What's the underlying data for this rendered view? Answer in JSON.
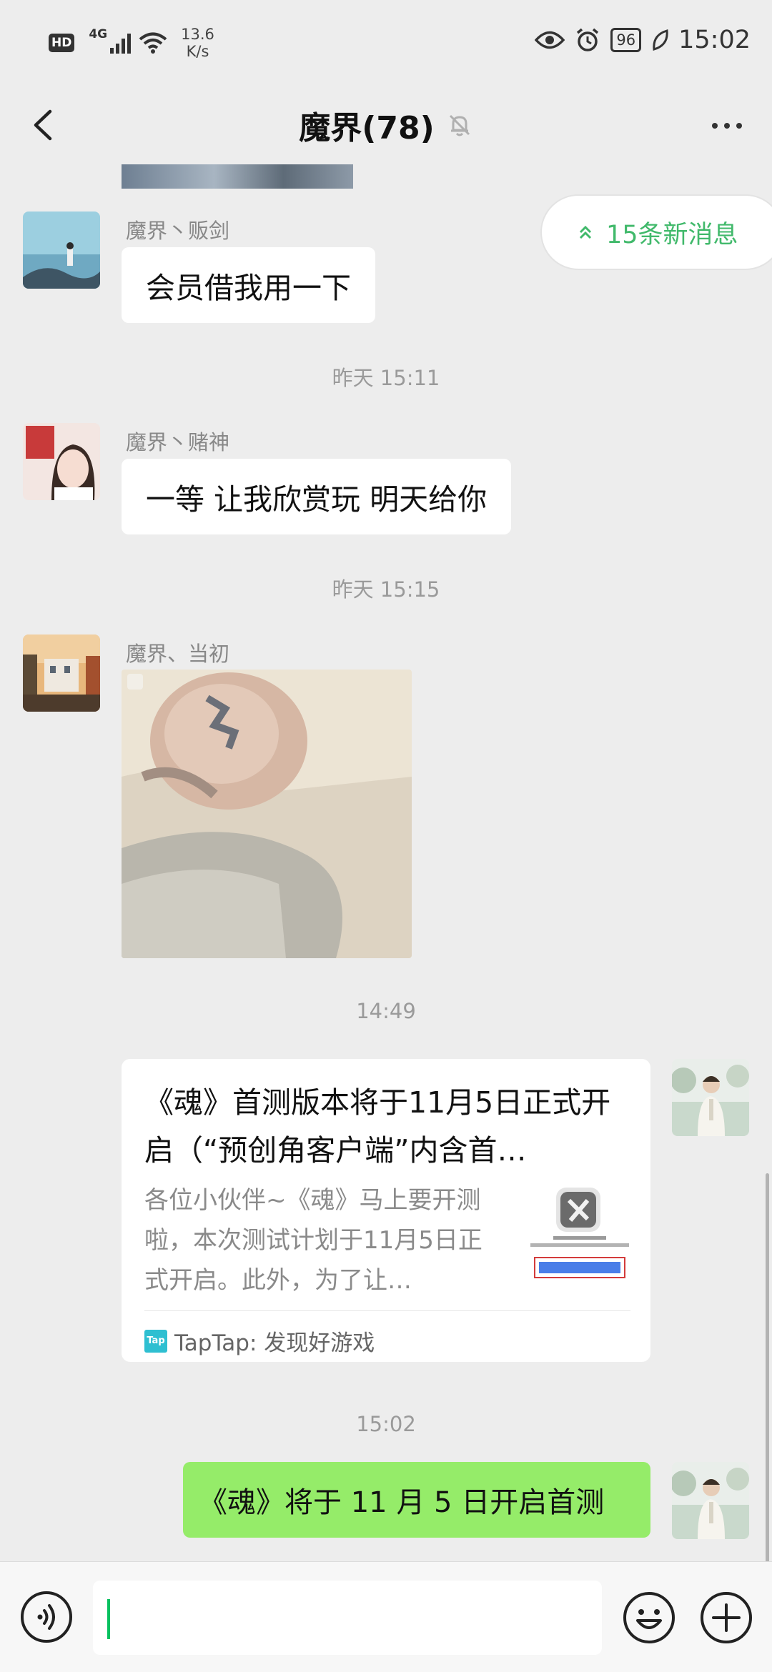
{
  "status_bar": {
    "hd": "HD",
    "network": "4G",
    "speed_value": "13.6",
    "speed_unit": "K/s",
    "battery": "96",
    "time": "15:02"
  },
  "header": {
    "title": "魔界(78)",
    "back_icon": "chevron-left-icon",
    "mute_icon": "bell-muted-icon",
    "more_icon": "more-dots-icon"
  },
  "new_messages_pill": "15条新消息",
  "messages": [
    {
      "sender": "魔界丶贩剑",
      "text": "会员借我用一下"
    },
    {
      "sender": "魔界丶赌神",
      "text": "一等   让我欣赏玩  明天给你"
    },
    {
      "sender": "魔界、当初",
      "kind": "image"
    }
  ],
  "timestamps": [
    "昨天 15:11",
    "昨天 15:15",
    "14:49",
    "15:02"
  ],
  "link_card": {
    "title": "《魂》首测版本将于11月5日正式开启（“预创角客户端”内含首…",
    "description": "各位小伙伴~《魂》马上要开测啦，本次测试计划于11月5日正式开启。此外，为了让…",
    "source": "TapTap: 发现好游戏",
    "source_icon_text": "Tap"
  },
  "outgoing_message": "《魂》将于 11 月 5 日开启首测",
  "input": {
    "value": "",
    "voice_icon": "voice-icon",
    "emoji_icon": "emoji-icon",
    "plus_icon": "plus-icon"
  },
  "colors": {
    "background": "#ededed",
    "outgoing_bubble": "#95ec69",
    "accent_green": "#41b96b",
    "caret": "#07c160"
  }
}
